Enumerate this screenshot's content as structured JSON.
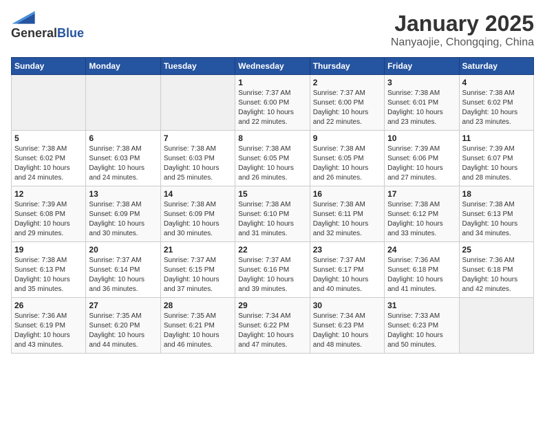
{
  "logo": {
    "general": "General",
    "blue": "Blue"
  },
  "title": "January 2025",
  "subtitle": "Nanyaojie, Chongqing, China",
  "weekdays": [
    "Sunday",
    "Monday",
    "Tuesday",
    "Wednesday",
    "Thursday",
    "Friday",
    "Saturday"
  ],
  "weeks": [
    [
      {
        "day": "",
        "info": ""
      },
      {
        "day": "",
        "info": ""
      },
      {
        "day": "",
        "info": ""
      },
      {
        "day": "1",
        "info": "Sunrise: 7:37 AM\nSunset: 6:00 PM\nDaylight: 10 hours\nand 22 minutes."
      },
      {
        "day": "2",
        "info": "Sunrise: 7:37 AM\nSunset: 6:00 PM\nDaylight: 10 hours\nand 22 minutes."
      },
      {
        "day": "3",
        "info": "Sunrise: 7:38 AM\nSunset: 6:01 PM\nDaylight: 10 hours\nand 23 minutes."
      },
      {
        "day": "4",
        "info": "Sunrise: 7:38 AM\nSunset: 6:02 PM\nDaylight: 10 hours\nand 23 minutes."
      }
    ],
    [
      {
        "day": "5",
        "info": "Sunrise: 7:38 AM\nSunset: 6:02 PM\nDaylight: 10 hours\nand 24 minutes."
      },
      {
        "day": "6",
        "info": "Sunrise: 7:38 AM\nSunset: 6:03 PM\nDaylight: 10 hours\nand 24 minutes."
      },
      {
        "day": "7",
        "info": "Sunrise: 7:38 AM\nSunset: 6:03 PM\nDaylight: 10 hours\nand 25 minutes."
      },
      {
        "day": "8",
        "info": "Sunrise: 7:38 AM\nSunset: 6:05 PM\nDaylight: 10 hours\nand 26 minutes."
      },
      {
        "day": "9",
        "info": "Sunrise: 7:38 AM\nSunset: 6:05 PM\nDaylight: 10 hours\nand 26 minutes."
      },
      {
        "day": "10",
        "info": "Sunrise: 7:39 AM\nSunset: 6:06 PM\nDaylight: 10 hours\nand 27 minutes."
      },
      {
        "day": "11",
        "info": "Sunrise: 7:39 AM\nSunset: 6:07 PM\nDaylight: 10 hours\nand 28 minutes."
      }
    ],
    [
      {
        "day": "12",
        "info": "Sunrise: 7:39 AM\nSunset: 6:08 PM\nDaylight: 10 hours\nand 29 minutes."
      },
      {
        "day": "13",
        "info": "Sunrise: 7:38 AM\nSunset: 6:09 PM\nDaylight: 10 hours\nand 30 minutes."
      },
      {
        "day": "14",
        "info": "Sunrise: 7:38 AM\nSunset: 6:09 PM\nDaylight: 10 hours\nand 30 minutes."
      },
      {
        "day": "15",
        "info": "Sunrise: 7:38 AM\nSunset: 6:10 PM\nDaylight: 10 hours\nand 31 minutes."
      },
      {
        "day": "16",
        "info": "Sunrise: 7:38 AM\nSunset: 6:11 PM\nDaylight: 10 hours\nand 32 minutes."
      },
      {
        "day": "17",
        "info": "Sunrise: 7:38 AM\nSunset: 6:12 PM\nDaylight: 10 hours\nand 33 minutes."
      },
      {
        "day": "18",
        "info": "Sunrise: 7:38 AM\nSunset: 6:13 PM\nDaylight: 10 hours\nand 34 minutes."
      }
    ],
    [
      {
        "day": "19",
        "info": "Sunrise: 7:38 AM\nSunset: 6:13 PM\nDaylight: 10 hours\nand 35 minutes."
      },
      {
        "day": "20",
        "info": "Sunrise: 7:37 AM\nSunset: 6:14 PM\nDaylight: 10 hours\nand 36 minutes."
      },
      {
        "day": "21",
        "info": "Sunrise: 7:37 AM\nSunset: 6:15 PM\nDaylight: 10 hours\nand 37 minutes."
      },
      {
        "day": "22",
        "info": "Sunrise: 7:37 AM\nSunset: 6:16 PM\nDaylight: 10 hours\nand 39 minutes."
      },
      {
        "day": "23",
        "info": "Sunrise: 7:37 AM\nSunset: 6:17 PM\nDaylight: 10 hours\nand 40 minutes."
      },
      {
        "day": "24",
        "info": "Sunrise: 7:36 AM\nSunset: 6:18 PM\nDaylight: 10 hours\nand 41 minutes."
      },
      {
        "day": "25",
        "info": "Sunrise: 7:36 AM\nSunset: 6:18 PM\nDaylight: 10 hours\nand 42 minutes."
      }
    ],
    [
      {
        "day": "26",
        "info": "Sunrise: 7:36 AM\nSunset: 6:19 PM\nDaylight: 10 hours\nand 43 minutes."
      },
      {
        "day": "27",
        "info": "Sunrise: 7:35 AM\nSunset: 6:20 PM\nDaylight: 10 hours\nand 44 minutes."
      },
      {
        "day": "28",
        "info": "Sunrise: 7:35 AM\nSunset: 6:21 PM\nDaylight: 10 hours\nand 46 minutes."
      },
      {
        "day": "29",
        "info": "Sunrise: 7:34 AM\nSunset: 6:22 PM\nDaylight: 10 hours\nand 47 minutes."
      },
      {
        "day": "30",
        "info": "Sunrise: 7:34 AM\nSunset: 6:23 PM\nDaylight: 10 hours\nand 48 minutes."
      },
      {
        "day": "31",
        "info": "Sunrise: 7:33 AM\nSunset: 6:23 PM\nDaylight: 10 hours\nand 50 minutes."
      },
      {
        "day": "",
        "info": ""
      }
    ]
  ]
}
